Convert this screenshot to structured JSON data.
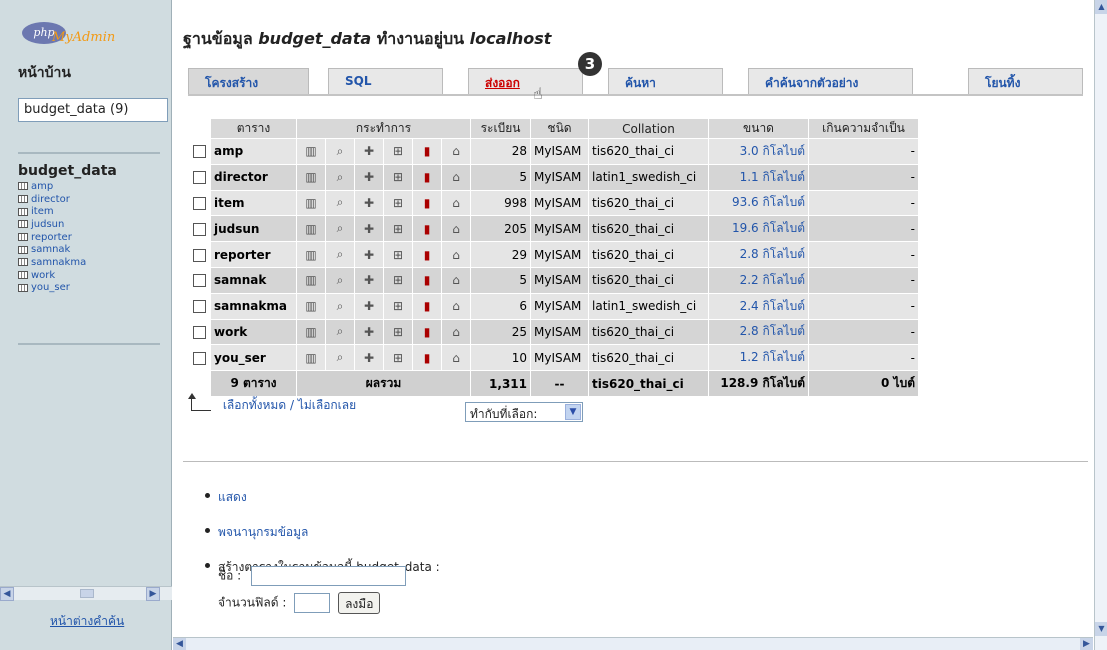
{
  "left": {
    "logo_php": "php",
    "logo_myadmin": "MyAdmin",
    "home": "หน้าบ้าน",
    "db_select": "budget_data (9)",
    "db_title": "budget_data",
    "tables": [
      "amp",
      "director",
      "item",
      "judsun",
      "reporter",
      "samnak",
      "samnakma",
      "work",
      "you_ser"
    ],
    "query_window": "หน้าต่างคำค้น"
  },
  "title": {
    "prefix": "ฐานข้อมูล ",
    "db": "budget_data",
    "middle": " ทำงานอยู่บน ",
    "host": "localhost"
  },
  "tabs": [
    "โครงสร้าง",
    "SQL",
    "ส่งออก",
    "ค้นหา",
    "คำค้นจากตัวอย่าง",
    "โยนทิ้ง"
  ],
  "step_badge": "3",
  "table_headers": {
    "table": "ตาราง",
    "action": "กระทำการ",
    "records": "ระเบียน",
    "type": "ชนิด",
    "collation": "Collation",
    "size": "ขนาด",
    "overhead": "เกินความจำเป็น"
  },
  "rows": [
    {
      "name": "amp",
      "records": "28",
      "engine": "MyISAM",
      "collation": "tis620_thai_ci",
      "size": "3.0 กิโลไบต์",
      "overhead": "-"
    },
    {
      "name": "director",
      "records": "5",
      "engine": "MyISAM",
      "collation": "latin1_swedish_ci",
      "size": "1.1 กิโลไบต์",
      "overhead": "-"
    },
    {
      "name": "item",
      "records": "998",
      "engine": "MyISAM",
      "collation": "tis620_thai_ci",
      "size": "93.6 กิโลไบต์",
      "overhead": "-"
    },
    {
      "name": "judsun",
      "records": "205",
      "engine": "MyISAM",
      "collation": "tis620_thai_ci",
      "size": "19.6 กิโลไบต์",
      "overhead": "-"
    },
    {
      "name": "reporter",
      "records": "29",
      "engine": "MyISAM",
      "collation": "tis620_thai_ci",
      "size": "2.8 กิโลไบต์",
      "overhead": "-"
    },
    {
      "name": "samnak",
      "records": "5",
      "engine": "MyISAM",
      "collation": "tis620_thai_ci",
      "size": "2.2 กิโลไบต์",
      "overhead": "-"
    },
    {
      "name": "samnakma",
      "records": "6",
      "engine": "MyISAM",
      "collation": "latin1_swedish_ci",
      "size": "2.4 กิโลไบต์",
      "overhead": "-"
    },
    {
      "name": "work",
      "records": "25",
      "engine": "MyISAM",
      "collation": "tis620_thai_ci",
      "size": "2.8 กิโลไบต์",
      "overhead": "-"
    },
    {
      "name": "you_ser",
      "records": "10",
      "engine": "MyISAM",
      "collation": "tis620_thai_ci",
      "size": "1.2 กิโลไบต์",
      "overhead": "-"
    }
  ],
  "summary": {
    "tables": "9 ตาราง",
    "label": "ผลรวม",
    "records": "1,311",
    "engine": "--",
    "collation": "tis620_thai_ci",
    "size": "128.9 กิโลไบต์",
    "overhead": "0 ไบต์"
  },
  "select_all": "เลือกทั้งหมด",
  "select_sep": " / ",
  "select_none": "ไม่เลือกเลย",
  "with_selected": "ทำกับที่เลือก:",
  "links": {
    "print": "แสดง",
    "dictionary": "พจนานุกรมข้อมูล",
    "create_table": "สร้างตารางในฐานข้อมูลนี้ budget_data :",
    "name_label": "ชื่อ :",
    "fields_label": "จำนวนฟิลด์ :",
    "go_button": "ลงมือ"
  }
}
